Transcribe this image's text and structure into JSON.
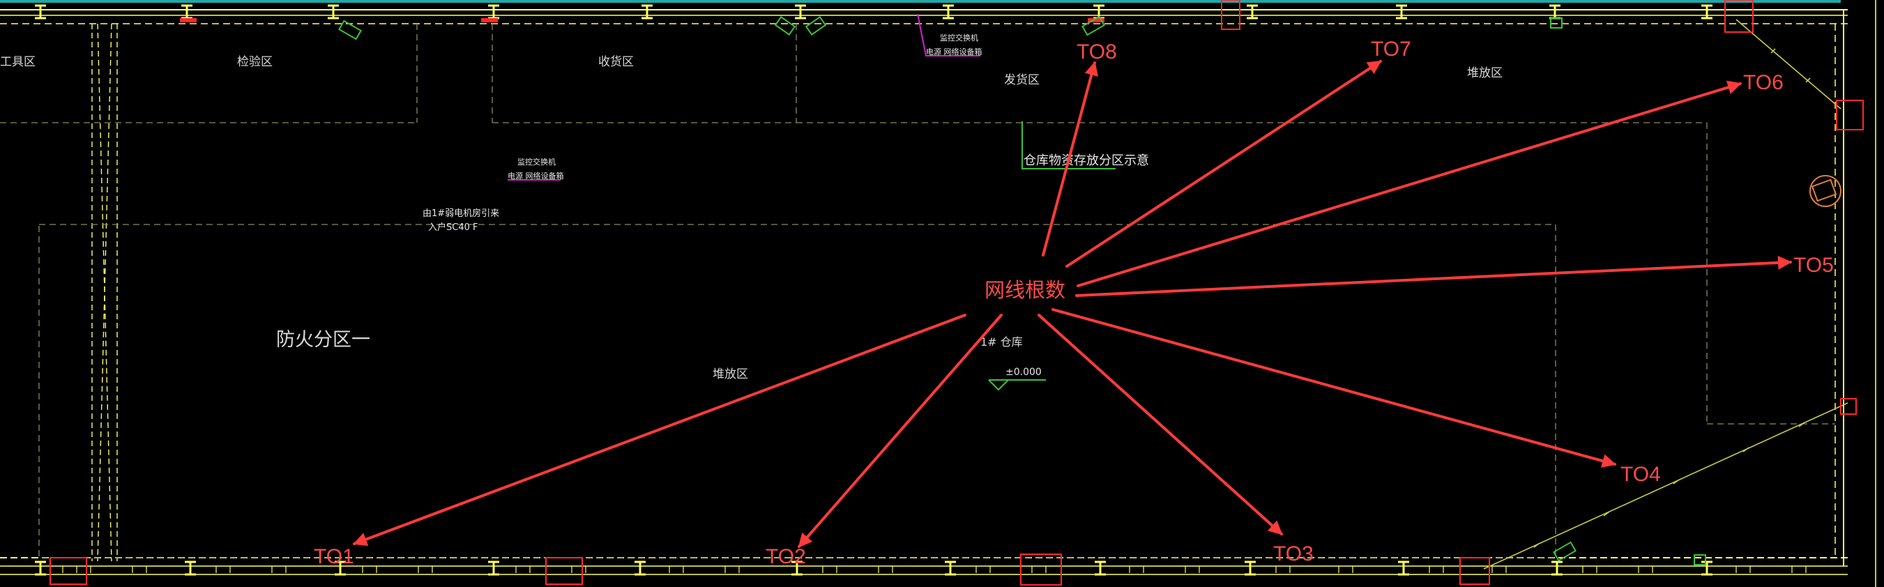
{
  "colors": {
    "background": "#000000",
    "wall": "#ffff66",
    "dashed": "#9a9a5a",
    "arrow": "#ff3b3b",
    "box": "#ff2a2a",
    "green": "#3cc23c",
    "magenta": "#cc22cc",
    "text": "#d8d8d8"
  },
  "zones": {
    "tool_area": "工具区",
    "inspection_area": "检验区",
    "receiving_area": "收货区",
    "shipping_area": "发货区",
    "storage_area_top": "堆放区",
    "storage_area_main": "堆放区",
    "fire_zone": "防火分区一",
    "warehouse_name": "1# 仓库",
    "elevation": "±0.000"
  },
  "annotations": {
    "warehouse_zoning_note": "仓库物资存放分区示意",
    "monitor_switch_1": "监控交换机",
    "power_network_1": "电源 网络设备箱",
    "monitor_switch_2": "监控交换机",
    "power_network_2": "电源 网络设备箱",
    "cable_note_1": "由1#弱电机房引来",
    "cable_note_2": "入户SC40 F"
  },
  "hub": {
    "label": "网线根数"
  },
  "outlets": [
    {
      "id": "to1",
      "label": "TO1"
    },
    {
      "id": "to2",
      "label": "TO2"
    },
    {
      "id": "to3",
      "label": "TO3"
    },
    {
      "id": "to4",
      "label": "TO4"
    },
    {
      "id": "to5",
      "label": "TO5"
    },
    {
      "id": "to6",
      "label": "TO6"
    },
    {
      "id": "to7",
      "label": "TO7"
    },
    {
      "id": "to8",
      "label": "TO8"
    }
  ]
}
